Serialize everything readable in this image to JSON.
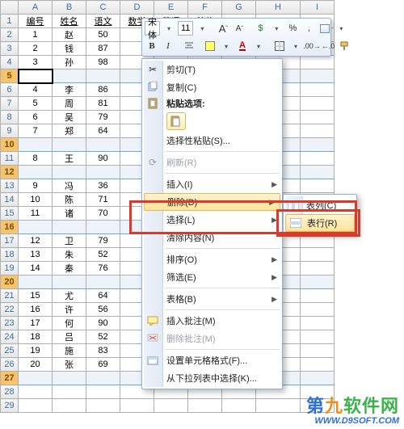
{
  "columns": [
    "A",
    "B",
    "C",
    "D",
    "E",
    "F",
    "G",
    "H",
    "I"
  ],
  "header_row": {
    "bianhao": "编号",
    "xingming": "姓名",
    "yuwen": "语文",
    "shuxue": "数学",
    "yingyu": "英语",
    "zongfen": "总分"
  },
  "rows": [
    {
      "r": 1
    },
    {
      "r": 2,
      "A": "1",
      "B": "赵",
      "C": "50"
    },
    {
      "r": 3,
      "A": "2",
      "B": "钱",
      "C": "87"
    },
    {
      "r": 4,
      "A": "3",
      "B": "孙",
      "C": "98"
    },
    {
      "r": 5,
      "sel": true,
      "active": true
    },
    {
      "r": 6,
      "A": "4",
      "B": "李",
      "C": "86"
    },
    {
      "r": 7,
      "A": "5",
      "B": "周",
      "C": "81"
    },
    {
      "r": 8,
      "A": "6",
      "B": "吴",
      "C": "79"
    },
    {
      "r": 9,
      "A": "7",
      "B": "郑",
      "C": "64"
    },
    {
      "r": 10,
      "sel": true
    },
    {
      "r": 11,
      "A": "8",
      "B": "王",
      "C": "90"
    },
    {
      "r": 12,
      "sel": true
    },
    {
      "r": 13,
      "A": "9",
      "B": "冯",
      "C": "36"
    },
    {
      "r": 14,
      "A": "10",
      "B": "陈",
      "C": "71"
    },
    {
      "r": 15,
      "A": "11",
      "B": "诸",
      "C": "70"
    },
    {
      "r": 16,
      "sel": true
    },
    {
      "r": 17,
      "A": "12",
      "B": "卫",
      "C": "79"
    },
    {
      "r": 18,
      "A": "13",
      "B": "朱",
      "C": "52"
    },
    {
      "r": 19,
      "A": "14",
      "B": "秦",
      "C": "76"
    },
    {
      "r": 20,
      "sel": true
    },
    {
      "r": 21,
      "A": "15",
      "B": "尤",
      "C": "64"
    },
    {
      "r": 22,
      "A": "16",
      "B": "许",
      "C": "56"
    },
    {
      "r": 23,
      "A": "17",
      "B": "何",
      "C": "90"
    },
    {
      "r": 24,
      "A": "18",
      "B": "吕",
      "C": "52"
    },
    {
      "r": 25,
      "A": "19",
      "B": "施",
      "C": "83"
    },
    {
      "r": 26,
      "A": "20",
      "B": "张",
      "C": "69"
    },
    {
      "r": 27,
      "sel": true
    },
    {
      "r": 28
    },
    {
      "r": 29
    }
  ],
  "minitb": {
    "font": "宋体",
    "size": "11",
    "bold": "B",
    "italic": "I",
    "percent": "%",
    "comma": ",",
    "grow_a": "A",
    "shrink_a": "A",
    "color_a": "A"
  },
  "ctx": {
    "cut": "剪切(T)",
    "copy": "复制(C)",
    "paste_opts_label": "粘贴选项:",
    "paste_special": "选择性粘贴(S)...",
    "refresh": "刷新(R)",
    "insert": "插入(I)",
    "delete": "删除(D)",
    "select": "选择(L)",
    "clear": "清除内容(N)",
    "sort": "排序(O)",
    "filter": "筛选(E)",
    "table": "表格(B)",
    "insert_comment": "插入批注(M)",
    "delete_comment": "删除批注(M)",
    "format_cells": "设置单元格格式(F)...",
    "pick_list": "从下拉列表中选择(K)..."
  },
  "submenu": {
    "columns": "表列(C)",
    "rows": "表行(R)"
  },
  "watermark": {
    "brand": "第九软件网",
    "url": "WWW.D9SOFT.COM"
  }
}
